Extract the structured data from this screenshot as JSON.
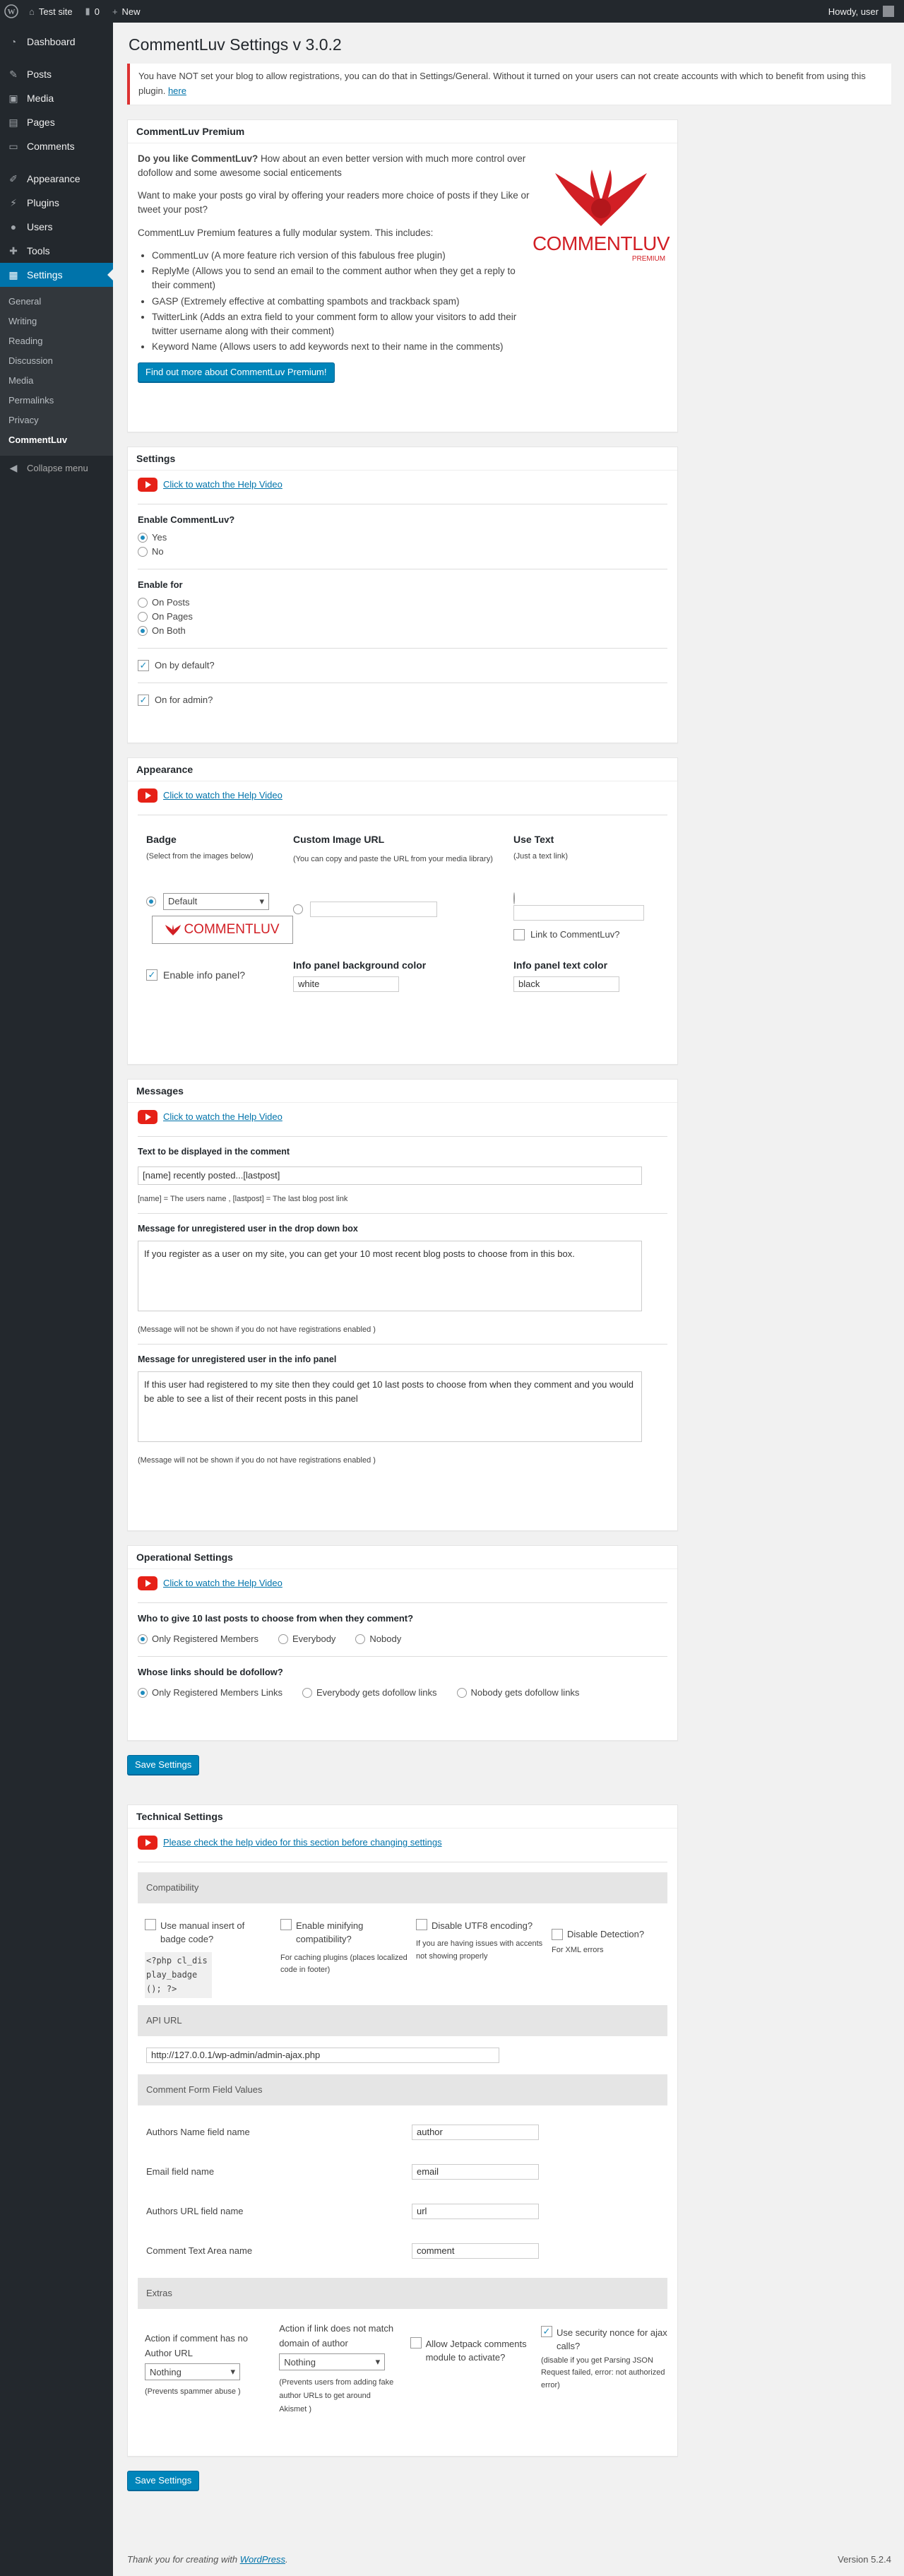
{
  "adminbar": {
    "site_name": "Test site",
    "comments_count": "0",
    "new_label": "New",
    "howdy": "Howdy, user"
  },
  "sidebar": {
    "items": [
      {
        "label": "Dashboard",
        "icon": "dashboard-icon"
      },
      {
        "label": "Posts",
        "icon": "posts-icon"
      },
      {
        "label": "Media",
        "icon": "media-icon"
      },
      {
        "label": "Pages",
        "icon": "pages-icon"
      },
      {
        "label": "Comments",
        "icon": "comments-icon"
      },
      {
        "label": "Appearance",
        "icon": "appearance-icon"
      },
      {
        "label": "Plugins",
        "icon": "plugins-icon"
      },
      {
        "label": "Users",
        "icon": "users-icon"
      },
      {
        "label": "Tools",
        "icon": "tools-icon"
      },
      {
        "label": "Settings",
        "icon": "settings-icon"
      }
    ],
    "submenu": [
      "General",
      "Writing",
      "Reading",
      "Discussion",
      "Media",
      "Permalinks",
      "Privacy",
      "CommentLuv"
    ],
    "collapse": "Collapse menu"
  },
  "page": {
    "title": "CommentLuv Settings v 3.0.2",
    "notice": "You have NOT set your blog to allow registrations, you can do that in Settings/General. Without it turned on your users can not create accounts with which to benefit from using this plugin.",
    "notice_link": "here"
  },
  "premium": {
    "title": "CommentLuv Premium",
    "q_strong": "Do you like CommentLuv?",
    "q_rest": " How about an even better version with much more control over dofollow and some awesome social enticements",
    "p2": "Want to make your posts go viral by offering your readers more choice of posts if they Like or tweet your post?",
    "p3": "CommentLuv Premium features a fully modular system. This includes:",
    "features": [
      "CommentLuv (A more feature rich version of this fabulous free plugin)",
      "ReplyMe (Allows you to send an email to the comment author when they get a reply to their comment)",
      "GASP (Extremely effective at combatting spambots and trackback spam)",
      "TwitterLink (Adds an extra field to your comment form to allow your visitors to add their twitter username along with their comment)",
      "Keyword Name (Allows users to add keywords next to their name in the comments)"
    ],
    "button": "Find out more about CommentLuv Premium!",
    "logo_text": "COMMENTLUV",
    "logo_sub": "PREMIUM"
  },
  "settings": {
    "title": "Settings",
    "help": "Click to watch the Help Video",
    "enable_label": "Enable CommentLuv?",
    "enable_yes": "Yes",
    "enable_no": "No",
    "enable_for_label": "Enable for",
    "enable_for": [
      "On Posts",
      "On Pages",
      "On Both"
    ],
    "default_label": "On by default?",
    "admin_label": "On for admin?"
  },
  "appearance": {
    "title": "Appearance",
    "help": "Click to watch the Help Video",
    "badge_label": "Badge",
    "badge_hint": "(Select from the images below)",
    "badge_select": "Default",
    "badge_text": "COMMENTLUV",
    "custom_label": "Custom Image URL",
    "custom_hint": "(You can copy and paste the URL from your media library)",
    "use_text_label": "Use Text",
    "use_text_hint": "(Just a text link)",
    "link_label": "Link to CommentLuv?",
    "info_panel_label": "Enable info panel?",
    "bg_color_label": "Info panel background color",
    "bg_color_value": "white",
    "text_color_label": "Info panel text color",
    "text_color_value": "black"
  },
  "messages": {
    "title": "Messages",
    "help": "Click to watch the Help Video",
    "comment_text_label": "Text to be displayed in the comment",
    "comment_text_value": "[name] recently posted...[lastpost]",
    "comment_text_hint": "[name] = The users name , [lastpost] = The last blog post link",
    "dropdown_label": "Message for unregistered user in the drop down box",
    "dropdown_value": "If you register as a user on my site, you can get your 10 most recent blog posts to choose from in this box.",
    "dropdown_hint": "(Message will not be shown if you do not have registrations enabled )",
    "infopanel_label": "Message for unregistered user in the info panel",
    "infopanel_value": "If this user had registered to my site then they could get 10 last posts to choose from when they comment and you would be able to see a list of their recent posts in this panel",
    "infopanel_hint": "(Message will not be shown if you do not have registrations enabled )"
  },
  "operational": {
    "title": "Operational Settings",
    "help": "Click to watch the Help Video",
    "who_label": "Who to give 10 last posts to choose from when they comment?",
    "who_options": [
      "Only Registered Members",
      "Everybody",
      "Nobody"
    ],
    "dofollow_label": "Whose links should be dofollow?",
    "dofollow_options": [
      "Only Registered Members Links",
      "Everybody gets dofollow links",
      "Nobody gets dofollow links"
    ]
  },
  "save_button": "Save Settings",
  "technical": {
    "title": "Technical Settings",
    "help": "Please check the help video for this section before changing settings",
    "compat_band": "Compatibility",
    "manual_label": "Use manual insert of badge code?",
    "manual_code": "<?php cl_display_badge(); ?>",
    "minify_label": "Enable minifying compatibility?",
    "minify_hint": "For caching plugins (places localized code in footer)",
    "utf8_label": "Disable UTF8 encoding?",
    "utf8_hint": "If you are having issues with accents not showing properly",
    "detect_label": "Disable Detection?",
    "detect_hint": "For XML errors",
    "api_band": "API URL",
    "api_value": "http://127.0.0.1/wp-admin/admin-ajax.php",
    "fields_band": "Comment Form Field Values",
    "fields": [
      {
        "label": "Authors Name field name",
        "value": "author"
      },
      {
        "label": "Email field name",
        "value": "email"
      },
      {
        "label": "Authors URL field name",
        "value": "url"
      },
      {
        "label": "Comment Text Area name",
        "value": "comment"
      }
    ],
    "extras_band": "Extras",
    "no_url_label": "Action if comment has no Author URL",
    "no_url_select": "Nothing",
    "no_url_hint": "(Prevents spammer abuse )",
    "domain_label": "Action if link does not match domain of author",
    "domain_select": "Nothing",
    "domain_hint": "(Prevents users from adding fake author URLs to get around Akismet )",
    "jetpack_label": "Allow Jetpack comments module to activate?",
    "nonce_label": "Use security nonce for ajax calls?",
    "nonce_hint": "(disable if you get Parsing JSON Request failed, error: not authorized error)"
  },
  "footer": {
    "thanks": "Thank you for creating with",
    "wp_link": "WordPress",
    "version": "Version 5.2.4"
  },
  "colors": {
    "accent": "#0073aa",
    "button": "#0085ba",
    "notice_border": "#dc3232",
    "logo_red": "#d21f25",
    "youtube_red": "#e62117"
  }
}
